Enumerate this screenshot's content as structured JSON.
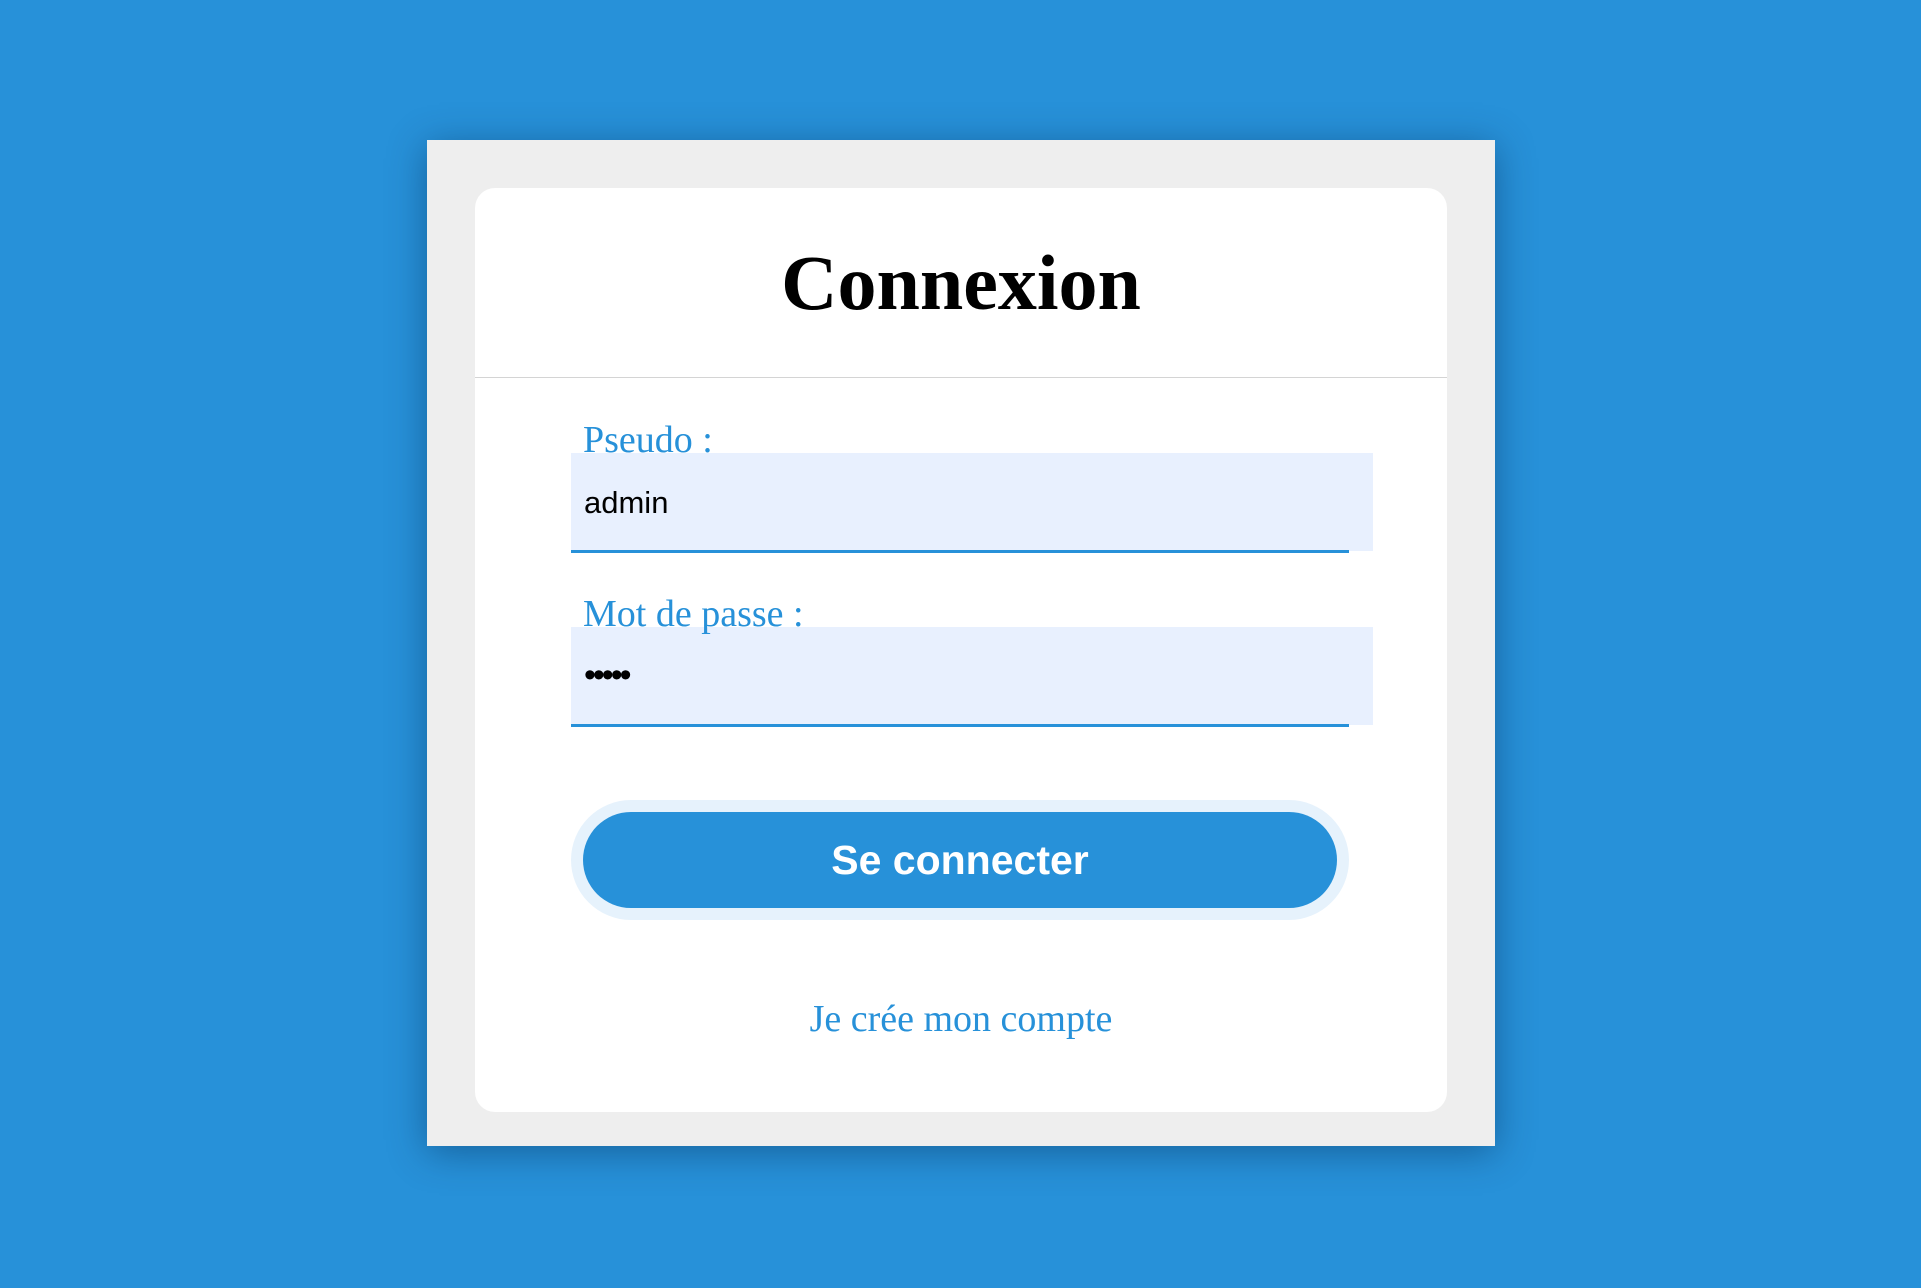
{
  "login": {
    "title": "Connexion",
    "username_label": "Pseudo :",
    "username_value": "admin",
    "password_label": "Mot de passe :",
    "password_value": "•••••",
    "submit_label": "Se connecter",
    "create_account_link": "Je crée mon compte"
  },
  "colors": {
    "background": "#2791d9",
    "frame": "#eeeeee",
    "card": "#ffffff",
    "accent": "#2791d9",
    "input_fill": "#e8f0fe",
    "button_text": "#ffffff"
  }
}
